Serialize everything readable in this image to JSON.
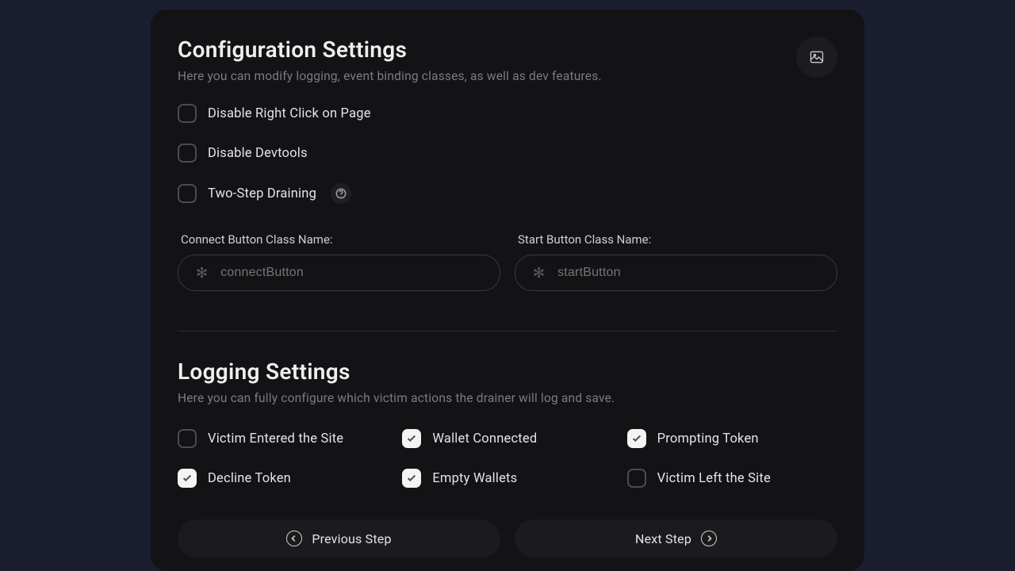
{
  "config": {
    "title": "Configuration Settings",
    "subtitle": "Here you can modify logging, event binding classes, as well as dev features.",
    "options": {
      "disable_right_click": {
        "label": "Disable Right Click on Page",
        "checked": false
      },
      "disable_devtools": {
        "label": "Disable Devtools",
        "checked": false
      },
      "two_step_draining": {
        "label": "Two-Step Draining",
        "checked": false
      }
    },
    "fields": {
      "connect": {
        "label": "Connect Button Class Name:",
        "placeholder": "connectButton",
        "value": ""
      },
      "start": {
        "label": "Start Button Class Name:",
        "placeholder": "startButton",
        "value": ""
      }
    }
  },
  "logging": {
    "title": "Logging Settings",
    "subtitle": "Here you can fully configure which victim actions the drainer will log and save.",
    "options": {
      "entered": {
        "label": "Victim Entered the Site",
        "checked": false
      },
      "wallet_connected": {
        "label": "Wallet Connected",
        "checked": true
      },
      "prompt_token": {
        "label": "Prompting Token",
        "checked": true
      },
      "decline_token": {
        "label": "Decline Token",
        "checked": true
      },
      "empty_wallets": {
        "label": "Empty Wallets",
        "checked": true
      },
      "left_site": {
        "label": "Victim Left the Site",
        "checked": false
      }
    }
  },
  "nav": {
    "prev": "Previous Step",
    "next": "Next Step"
  }
}
